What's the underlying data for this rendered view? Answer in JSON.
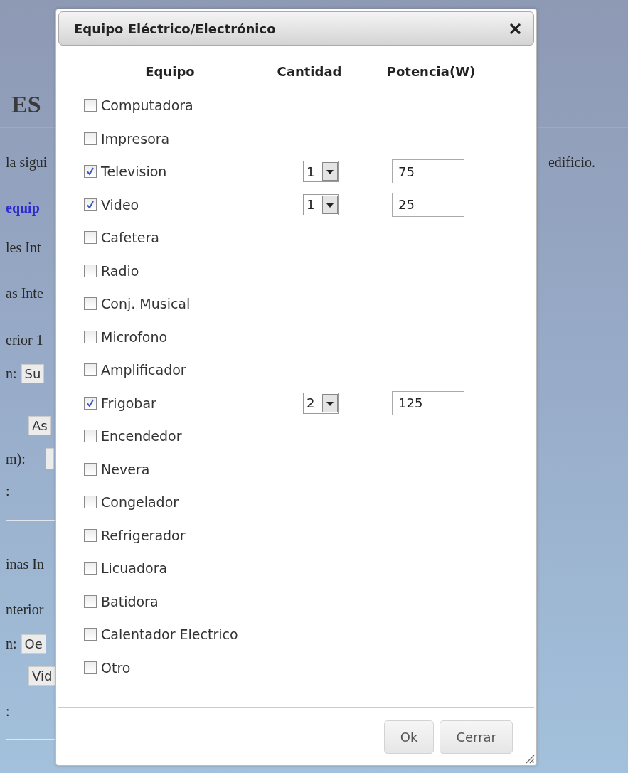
{
  "page": {
    "heading": "ES",
    "lines": [
      {
        "kind": "text",
        "text": "la sigui",
        "right": "edificio."
      },
      {
        "kind": "link",
        "text": "equip"
      },
      {
        "kind": "text",
        "text": "les Int"
      },
      {
        "kind": "text",
        "text": "as Inte"
      },
      {
        "kind": "text",
        "text": "erior 1"
      },
      {
        "kind": "button",
        "label": "n:",
        "button": "Su"
      },
      {
        "kind": "button",
        "button": "As"
      },
      {
        "kind": "field",
        "label": "m):"
      },
      {
        "kind": "text",
        "text": ":"
      },
      {
        "kind": "rule"
      },
      {
        "kind": "text",
        "text": "inas In"
      },
      {
        "kind": "text",
        "text": "nterior"
      },
      {
        "kind": "button",
        "label": "n:",
        "button": "Oe"
      },
      {
        "kind": "button",
        "button": "Vid"
      },
      {
        "kind": "text",
        "text": ":"
      },
      {
        "kind": "rule"
      }
    ]
  },
  "dialog": {
    "title": "Equipo Eléctrico/Electrónico",
    "columns": [
      "Equipo",
      "Cantidad",
      "Potencia(W)"
    ],
    "items": [
      {
        "label": "Computadora",
        "checked": false
      },
      {
        "label": "Impresora",
        "checked": false
      },
      {
        "label": "Television",
        "checked": true,
        "quantity": "1",
        "power": "75"
      },
      {
        "label": "Video",
        "checked": true,
        "quantity": "1",
        "power": "25"
      },
      {
        "label": "Cafetera",
        "checked": false
      },
      {
        "label": "Radio",
        "checked": false
      },
      {
        "label": "Conj. Musical",
        "checked": false
      },
      {
        "label": "Microfono",
        "checked": false
      },
      {
        "label": "Amplificador",
        "checked": false
      },
      {
        "label": "Frigobar",
        "checked": true,
        "quantity": "2",
        "power": "125"
      },
      {
        "label": "Encendedor",
        "checked": false
      },
      {
        "label": "Nevera",
        "checked": false
      },
      {
        "label": "Congelador",
        "checked": false
      },
      {
        "label": "Refrigerador",
        "checked": false
      },
      {
        "label": "Licuadora",
        "checked": false
      },
      {
        "label": "Batidora",
        "checked": false
      },
      {
        "label": "Calentador Electrico",
        "checked": false
      },
      {
        "label": "Otro",
        "checked": false
      }
    ],
    "buttons": [
      "Ok",
      "Cerrar"
    ]
  }
}
